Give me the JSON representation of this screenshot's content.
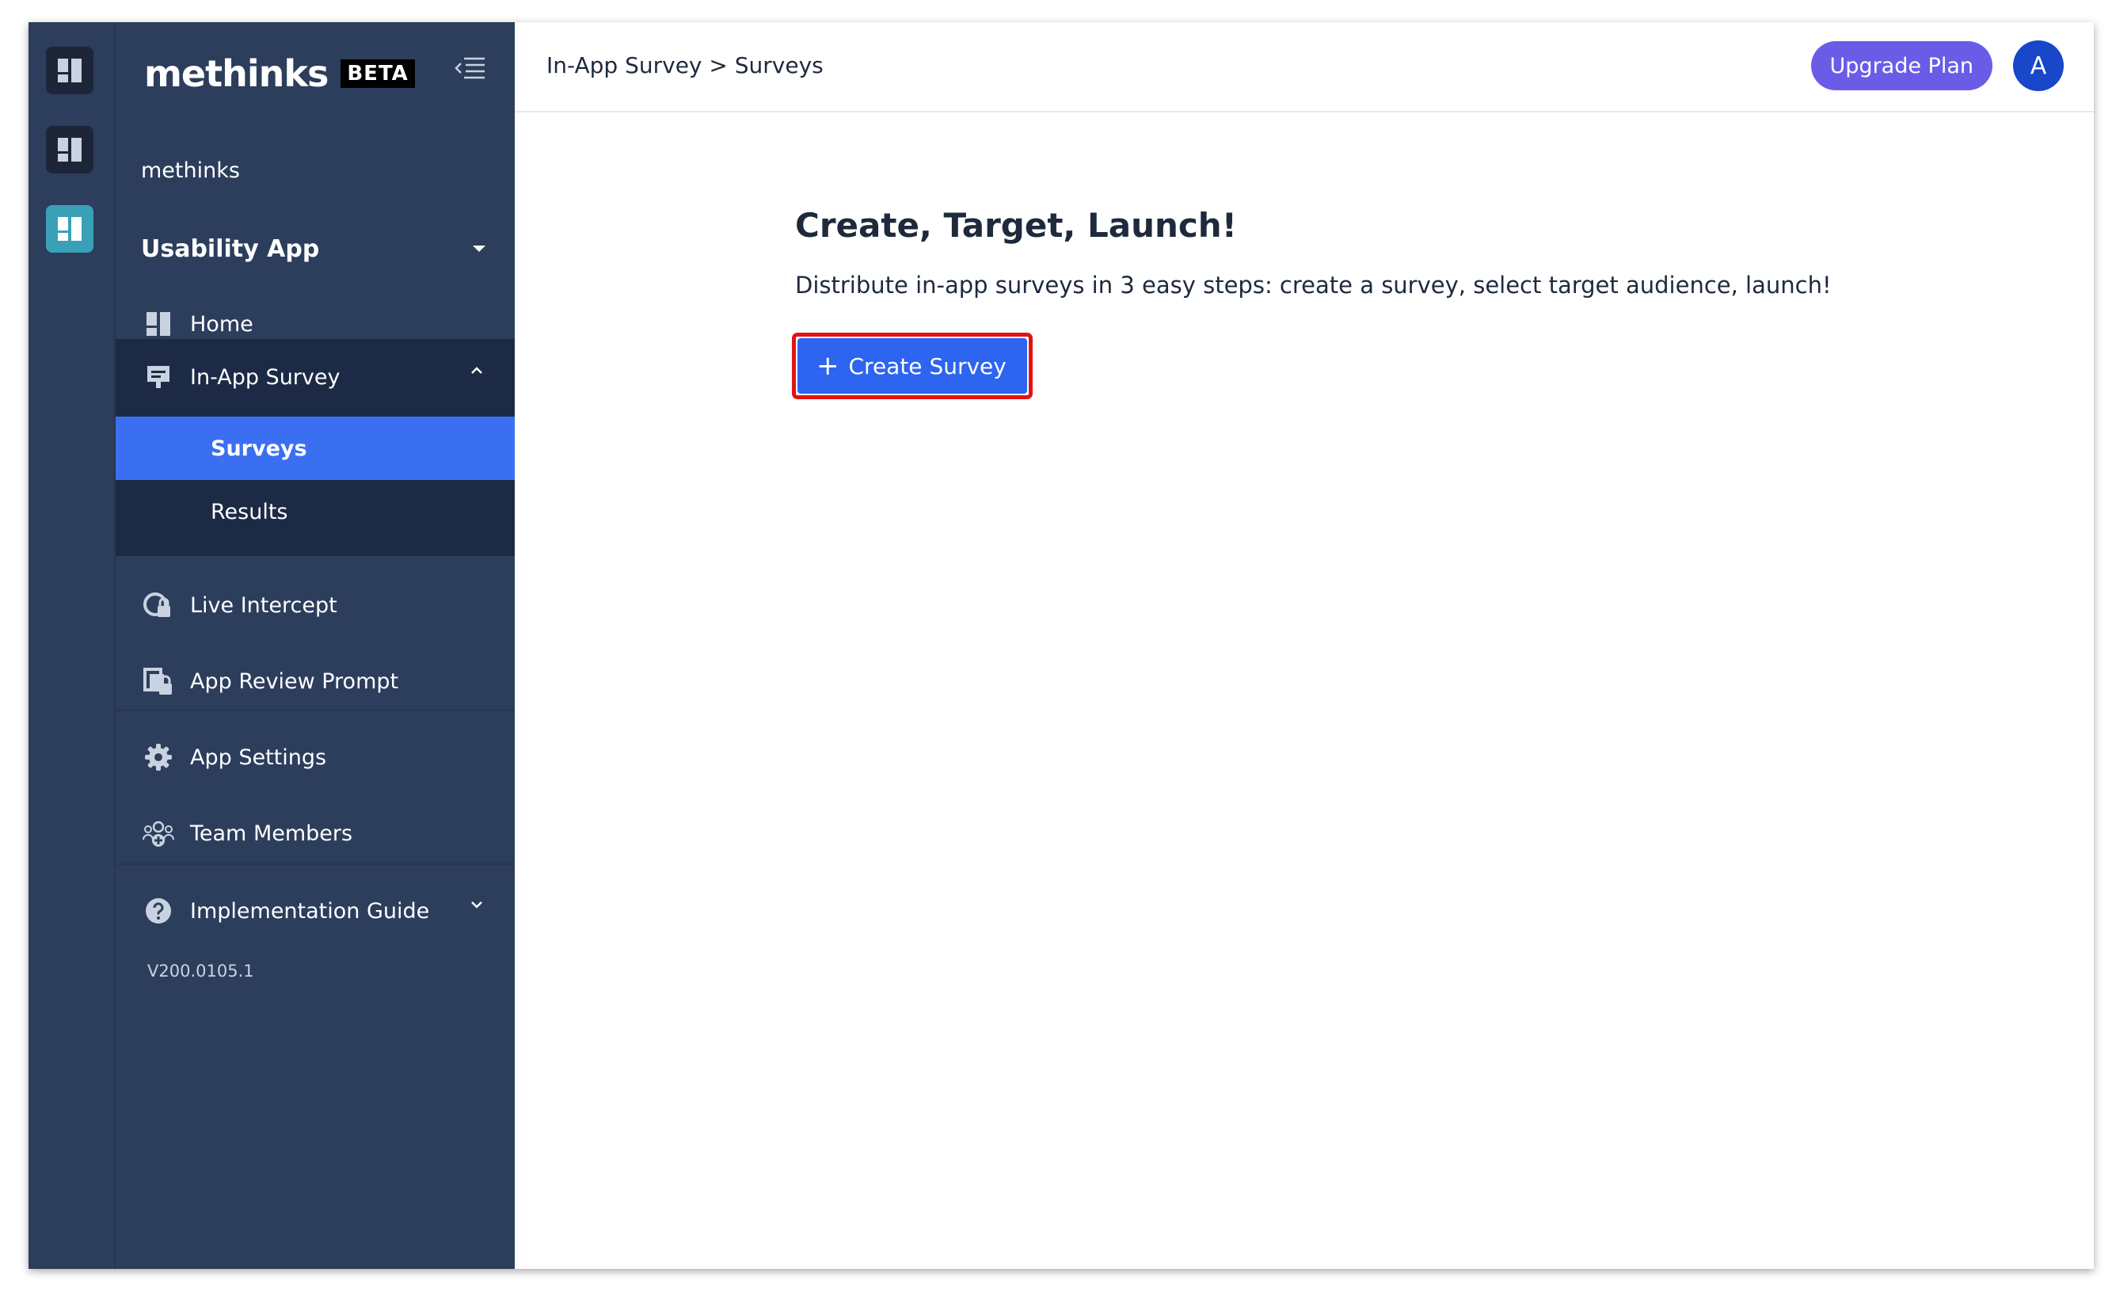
{
  "brand": {
    "logo": "methinks",
    "badge": "BETA"
  },
  "rail": {
    "items": [
      {
        "icon": "dashboard-icon"
      },
      {
        "icon": "dashboard-icon"
      },
      {
        "icon": "dashboard-icon"
      }
    ]
  },
  "sidebar": {
    "org": "methinks",
    "app_selector": "Usability App",
    "items": [
      {
        "label": "Home",
        "icon": "home-grid-icon"
      },
      {
        "label": "In-App Survey",
        "icon": "survey-icon"
      },
      {
        "label": "Live Intercept",
        "icon": "live-intercept-icon"
      },
      {
        "label": "App Review Prompt",
        "icon": "app-review-icon"
      },
      {
        "label": "App Settings",
        "icon": "gear-icon"
      },
      {
        "label": "Team Members",
        "icon": "team-icon"
      },
      {
        "label": "Implementation Guide",
        "icon": "help-icon"
      }
    ],
    "submenu": [
      {
        "label": "Surveys",
        "active": true
      },
      {
        "label": "Results",
        "active": false
      }
    ],
    "version": "V200.0105.1"
  },
  "header": {
    "breadcrumb": "In-App Survey > Surveys",
    "upgrade_label": "Upgrade Plan",
    "avatar_initial": "A"
  },
  "main": {
    "title": "Create, Target, Launch!",
    "description": "Distribute in-app surveys in 3 easy steps: create a survey, select target audience, launch!",
    "create_button_icon": "+",
    "create_button_label": "Create Survey"
  },
  "colors": {
    "sidebar_bg": "#2c3e5c",
    "submenu_bg": "#1c2a45",
    "active_item": "#3b6ff2",
    "upgrade": "#6b5ce7",
    "primary_button": "#2d64f0",
    "highlight_border": "#e11414"
  }
}
